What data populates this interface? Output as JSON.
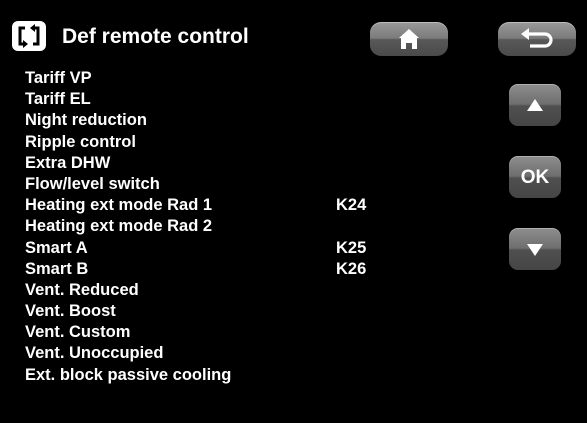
{
  "header": {
    "title": "Def remote control",
    "title_icon": "remote-control-arrows-icon",
    "home_icon": "home-icon",
    "back_icon": "back-arrow-icon"
  },
  "list": {
    "items": [
      {
        "label": "Tariff VP",
        "value": ""
      },
      {
        "label": "Tariff EL",
        "value": ""
      },
      {
        "label": "Night reduction",
        "value": ""
      },
      {
        "label": "Ripple control",
        "value": ""
      },
      {
        "label": "Extra DHW",
        "value": ""
      },
      {
        "label": "Flow/level switch",
        "value": ""
      },
      {
        "label": "Heating ext mode Rad 1",
        "value": "K24"
      },
      {
        "label": "Heating ext mode Rad 2",
        "value": ""
      },
      {
        "label": "Smart A",
        "value": "K25"
      },
      {
        "label": "Smart B",
        "value": "K26"
      },
      {
        "label": "Vent. Reduced",
        "value": ""
      },
      {
        "label": "Vent. Boost",
        "value": ""
      },
      {
        "label": "Vent. Custom",
        "value": ""
      },
      {
        "label": "Vent. Unoccupied",
        "value": ""
      },
      {
        "label": "Ext. block passive cooling",
        "value": ""
      }
    ]
  },
  "side": {
    "up_icon": "up-arrow-icon",
    "ok_label": "OK",
    "down_icon": "down-arrow-icon"
  },
  "colors": {
    "background": "#000000",
    "text": "#ffffff",
    "button": "#6e6e6e"
  }
}
